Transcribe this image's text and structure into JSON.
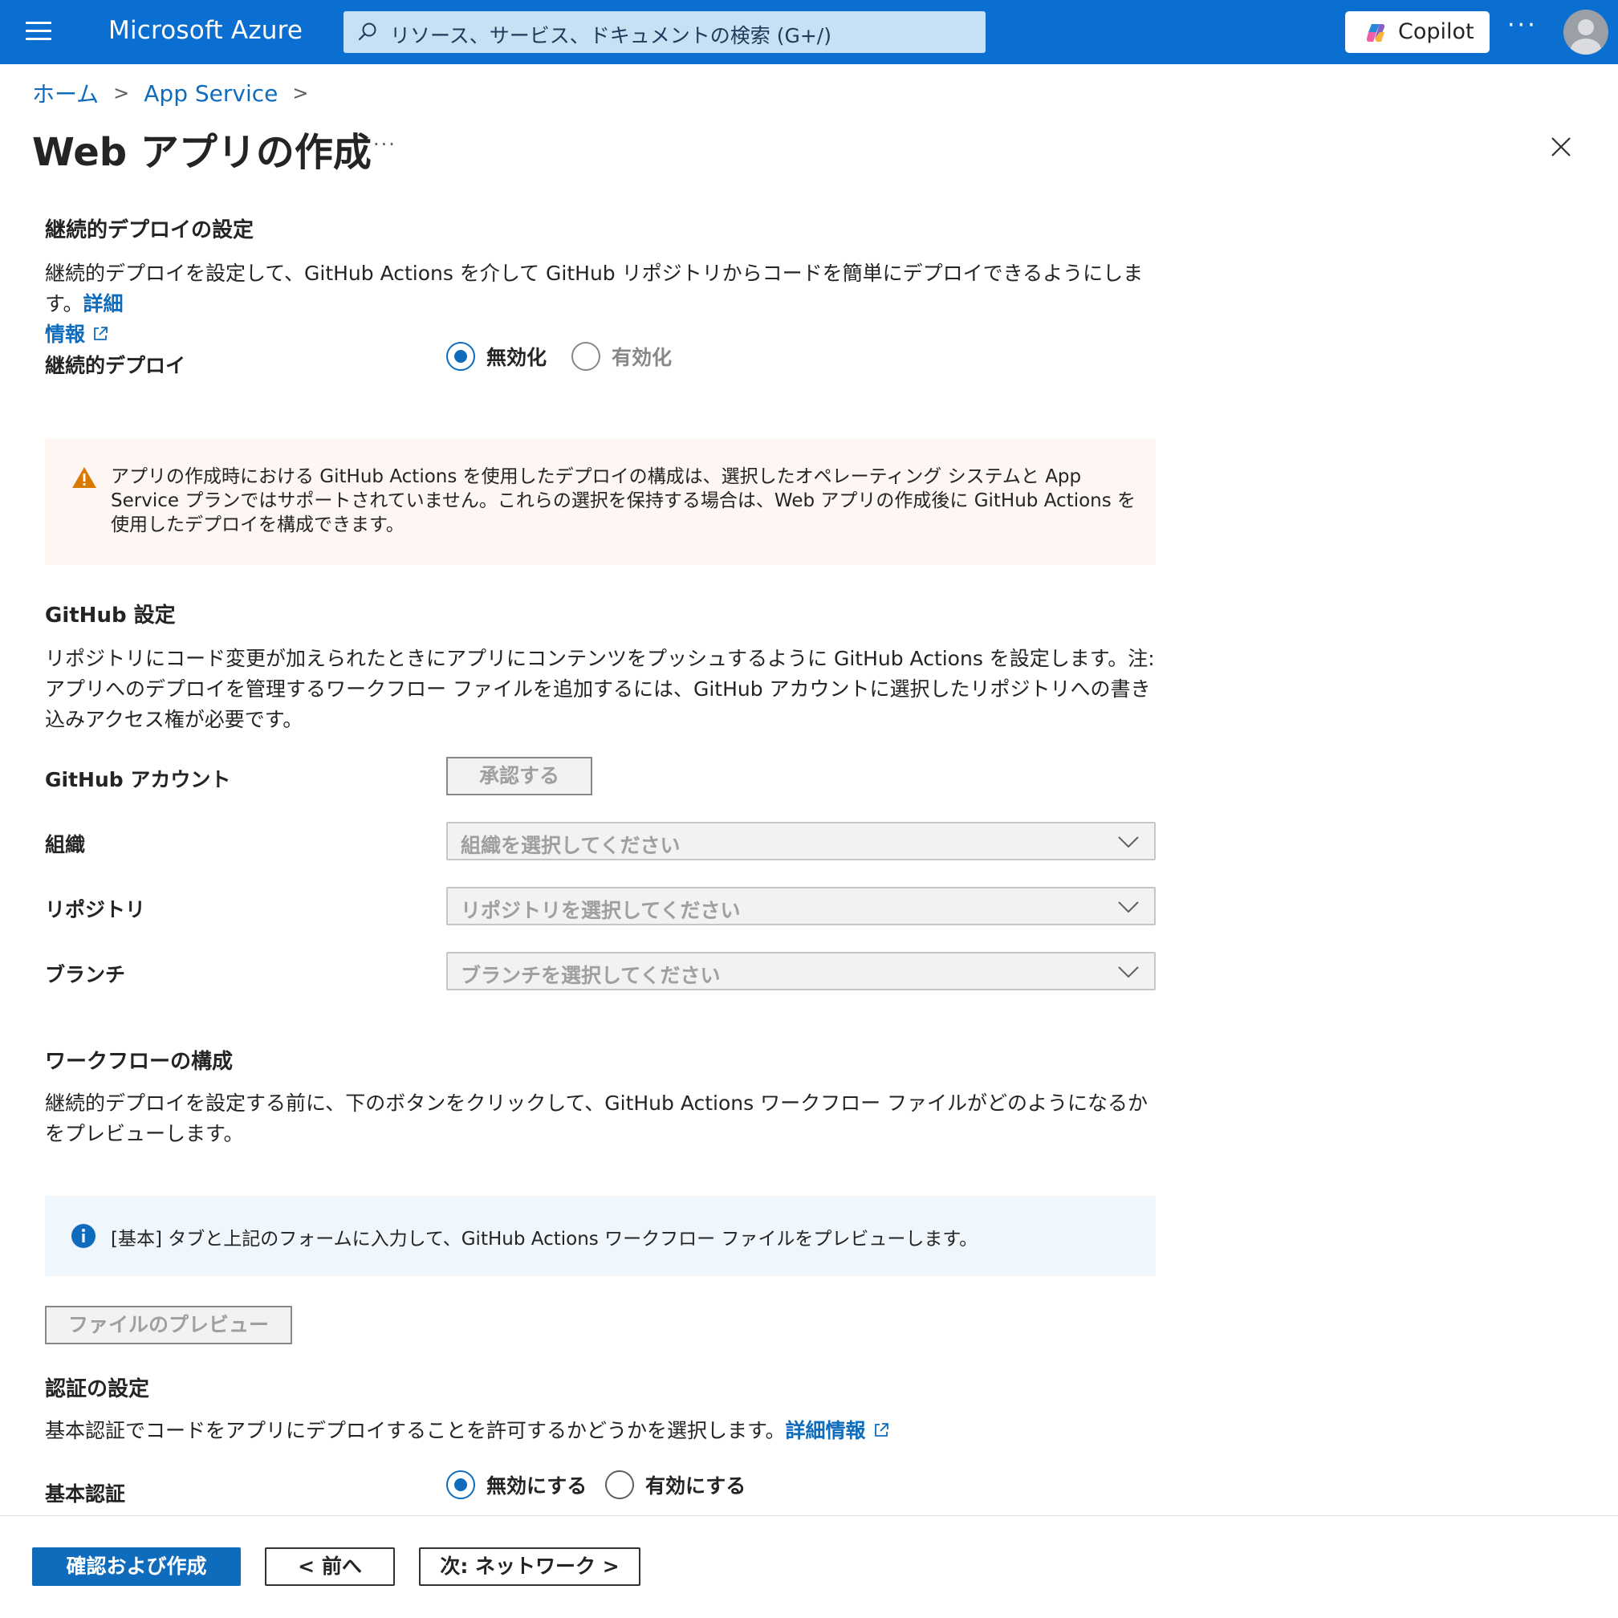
{
  "topbar": {
    "brand": "Microsoft Azure",
    "search_placeholder": "リソース、サービス、ドキュメントの検索 (G+/)",
    "copilot_label": "Copilot",
    "more": "···"
  },
  "breadcrumb": {
    "home": "ホーム",
    "app_service": "App Service"
  },
  "page": {
    "title": "Web アプリの作成",
    "more": "···"
  },
  "cd": {
    "heading": "継続的デプロイの設定",
    "desc": "継続的デプロイを設定して、GitHub Actions を介して GitHub リポジトリからコードを簡単にデプロイできるようにします。",
    "link_line1": "詳細",
    "link_line2": "情報",
    "label": "継続的デプロイ",
    "options": [
      "無効化",
      "有効化"
    ],
    "selected": "無効化"
  },
  "warning": {
    "text": "アプリの作成時における GitHub Actions を使用したデプロイの構成は、選択したオペレーティング システムと App Service プランではサポートされていません。これらの選択を保持する場合は、Web アプリの作成後に GitHub Actions を使用したデプロイを構成できます。"
  },
  "github": {
    "heading": "GitHub 設定",
    "desc": "リポジトリにコード変更が加えられたときにアプリにコンテンツをプッシュするように GitHub Actions を設定します。注: アプリへのデプロイを管理するワークフロー ファイルを追加するには、GitHub アカウントに選択したリポジトリへの書き込みアクセス権が必要です。",
    "account_label": "GitHub アカウント",
    "authorize_button": "承認する",
    "org_label": "組織",
    "org_placeholder": "組織を選択してください",
    "repo_label": "リポジトリ",
    "repo_placeholder": "リポジトリを選択してください",
    "branch_label": "ブランチ",
    "branch_placeholder": "ブランチを選択してください"
  },
  "workflow": {
    "heading": "ワークフローの構成",
    "desc": "継続的デプロイを設定する前に、下のボタンをクリックして、GitHub Actions ワークフロー ファイルがどのようになるかをプレビューします。",
    "info": "[基本] タブと上記のフォームに入力して、GitHub Actions ワークフロー ファイルをプレビューします。",
    "preview_button": "ファイルのプレビュー"
  },
  "auth": {
    "heading": "認証の設定",
    "desc": "基本認証でコードをアプリにデプロイすることを許可するかどうかを選択します。",
    "link": "詳細情報",
    "label": "基本認証",
    "options": [
      "無効にする",
      "有効にする"
    ],
    "selected": "無効にする"
  },
  "footer": {
    "review_create": "確認および作成",
    "prev": "< 前へ",
    "next": "次: ネットワーク >"
  },
  "colors": {
    "topbar": "#0b6fd1",
    "accent": "#0f6cbd",
    "warning_bg": "#fdf6f3",
    "info_bg": "#eff6fc"
  }
}
